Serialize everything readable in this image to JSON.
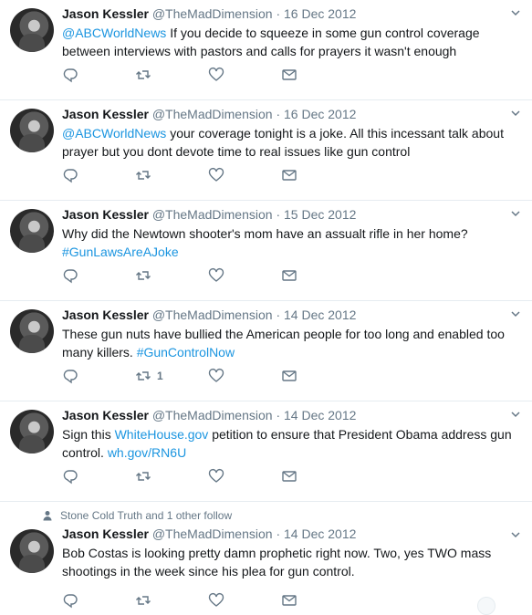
{
  "tweets": [
    {
      "name": "Jason Kessler",
      "handle": "@TheMadDimension",
      "date": "16 Dec 2012",
      "mention": "@ABCWorldNews",
      "text": " If you decide to squeeze in some gun control coverage between interviews with pastors and calls for prayers it wasn't enough",
      "hashtag": "",
      "retweets": ""
    },
    {
      "name": "Jason Kessler",
      "handle": "@TheMadDimension",
      "date": "16 Dec 2012",
      "mention": "@ABCWorldNews",
      "text": " your coverage tonight is a joke. All this incessant talk about prayer but you dont devote time to real issues like gun control",
      "hashtag": "",
      "retweets": ""
    },
    {
      "name": "Jason Kessler",
      "handle": "@TheMadDimension",
      "date": "15 Dec 2012",
      "mention": "",
      "text": "Why did the Newtown shooter's mom have an assualt rifle in her home? ",
      "hashtag": "#GunLawsAreAJoke",
      "retweets": ""
    },
    {
      "name": "Jason Kessler",
      "handle": "@TheMadDimension",
      "date": "14 Dec 2012",
      "mention": "",
      "text": "These gun nuts have bullied the American people for too long and enabled too many killers. ",
      "hashtag": "#GunControlNow",
      "retweets": "1"
    },
    {
      "name": "Jason Kessler",
      "handle": "@TheMadDimension",
      "date": "14 Dec 2012",
      "text_before": "Sign this ",
      "link1": "WhiteHouse.gov",
      "text_mid": " petition to ensure that President Obama address gun control. ",
      "link2": "wh.gov/RN6U",
      "retweets": ""
    },
    {
      "context": "Stone Cold Truth and 1 other follow",
      "name": "Jason Kessler",
      "handle": "@TheMadDimension",
      "date": "14 Dec 2012",
      "mention": "",
      "text": "Bob Costas is looking pretty damn prophetic right now. Two, yes TWO mass shootings in the week since his plea for gun control.",
      "hashtag": "",
      "retweets": ""
    }
  ],
  "icons": {
    "reply": "reply-icon",
    "retweet": "retweet-icon",
    "like": "like-icon",
    "dm": "direct-message-icon",
    "caret": "chevron-down-icon",
    "follow": "person-icon"
  },
  "colors": {
    "link": "#1b95e0",
    "secondary": "#657786",
    "divider": "#e6ecf0"
  }
}
